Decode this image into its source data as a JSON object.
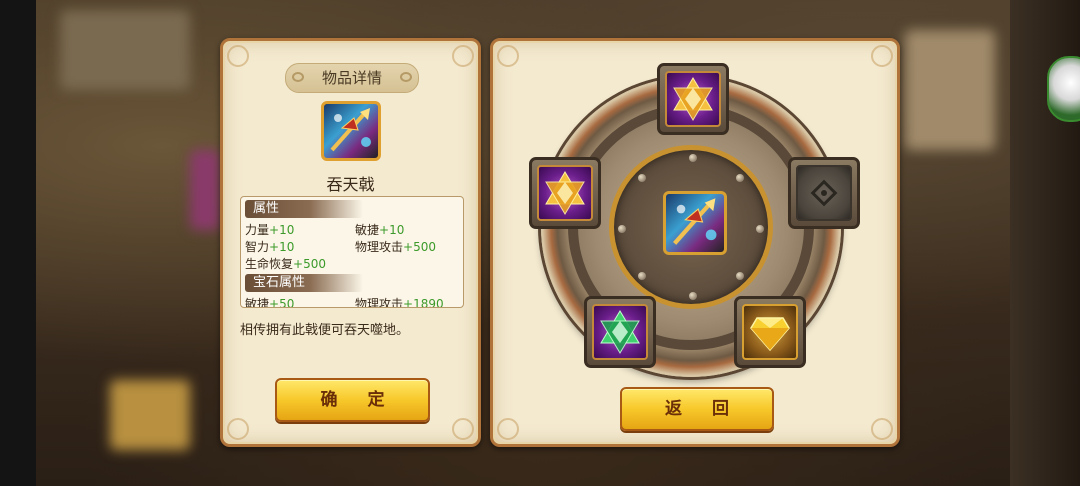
{
  "dialog": {
    "title": "物品详情",
    "item_name": "吞天戟",
    "attributes": {
      "header": "属性",
      "rows": [
        {
          "label": "力量",
          "value": "+10"
        },
        {
          "label": "敏捷",
          "value": "+10"
        },
        {
          "label": "智力",
          "value": "+10"
        },
        {
          "label": "物理攻击",
          "value": "+500"
        },
        {
          "label": "生命恢复",
          "value": "+500"
        }
      ]
    },
    "gem_attributes": {
      "header": "宝石属性",
      "rows": [
        {
          "label": "敏捷",
          "value": "+50"
        },
        {
          "label": "物理攻击",
          "value": "+1890"
        }
      ]
    },
    "description": "相传拥有此戟便可吞天噬地。",
    "confirm_label": "确 定"
  },
  "gem_panel": {
    "back_label": "返 回",
    "slots": [
      {
        "position": "top",
        "gem": "gold-star-gem-icon",
        "state": "filled"
      },
      {
        "position": "left",
        "gem": "gold-star-gem-icon",
        "state": "filled"
      },
      {
        "position": "right",
        "gem": "empty-slot-icon",
        "state": "empty"
      },
      {
        "position": "bottom-left",
        "gem": "green-star-gem-icon",
        "state": "filled"
      },
      {
        "position": "bottom-right",
        "gem": "yellow-diamond-gem-icon",
        "state": "filled"
      }
    ]
  },
  "colors": {
    "panel_bg": "#f4ead0",
    "panel_border": "#b0743a",
    "button_gold": "#f7c82a",
    "button_text": "#6a2e08",
    "value_green": "#3c9a2a",
    "section_header": "#6a4e36"
  }
}
